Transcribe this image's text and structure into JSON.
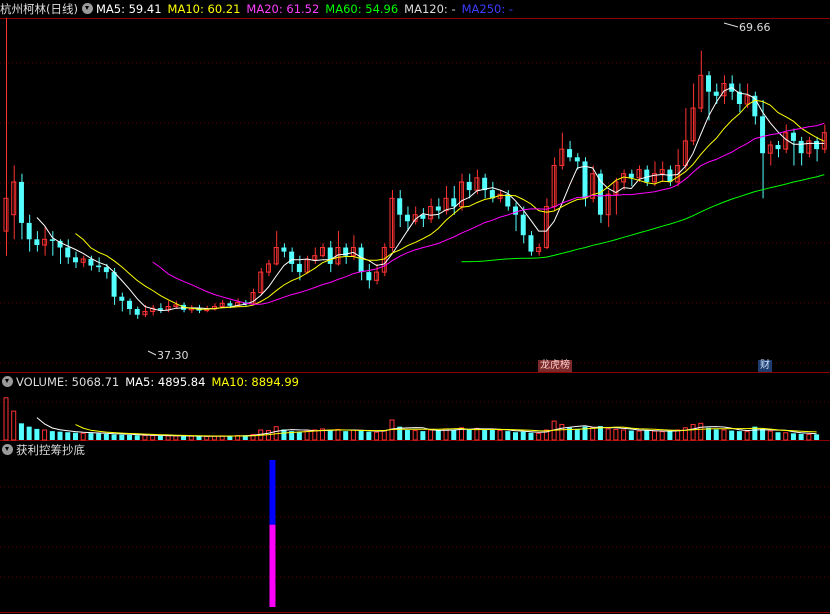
{
  "main_header": {
    "stock_label": "杭州柯林(日线)",
    "ma5": "MA5: 59.41",
    "ma10": "MA10: 60.21",
    "ma20": "MA20: 61.52",
    "ma60": "MA60: 54.96",
    "ma120": "MA120: -",
    "ma250": "MA250: -"
  },
  "volume_header": {
    "volume": "VOLUME: 5068.71",
    "ma5": "MA5: 4895.84",
    "ma10": "MA10: 8894.99"
  },
  "indicator_header": {
    "title": "获利控筹抄底"
  },
  "badges": {
    "lhb": "龙虎榜",
    "cai": "财"
  },
  "colors": {
    "up": "#ff3232",
    "down": "#54ffff",
    "ma5": "#ffffff",
    "ma10": "#ffff00",
    "ma20": "#ff00ff",
    "ma60": "#00ff00",
    "ma250": "#0000ff",
    "grid": "#8b0000",
    "bar_blue": "#0000ff",
    "bar_magenta": "#ff00ff"
  },
  "chart_data": [
    {
      "type": "candlestick",
      "name": "price",
      "y_range": [
        33.5,
        73.5
      ],
      "high_label": "69.66",
      "low_label": "37.30",
      "candles": [
        [
          48,
          52,
          45,
          74
        ],
        [
          50,
          54,
          47,
          56
        ],
        [
          54,
          49,
          47,
          55
        ],
        [
          49,
          47,
          45.5,
          50
        ],
        [
          47,
          46.3,
          45.5,
          48
        ],
        [
          46.3,
          47,
          45,
          48.5
        ],
        [
          47,
          46.8,
          45,
          48
        ],
        [
          46.8,
          46,
          44,
          47
        ],
        [
          46,
          44.8,
          44,
          47
        ],
        [
          44.8,
          44.2,
          43.5,
          45.5
        ],
        [
          44.2,
          44.6,
          43.6,
          45
        ],
        [
          44.6,
          43.8,
          43.2,
          45
        ],
        [
          43.8,
          43.6,
          43,
          44.8
        ],
        [
          43.6,
          43,
          42.2,
          44
        ],
        [
          43,
          40,
          39,
          43.5
        ],
        [
          40,
          39.5,
          38.2,
          40.5
        ],
        [
          39.5,
          38.5,
          37.8,
          39.8
        ],
        [
          38.5,
          37.8,
          37.3,
          38.8
        ],
        [
          37.8,
          38.2,
          37.5,
          39
        ],
        [
          38.2,
          38.6,
          37.7,
          39
        ],
        [
          38.6,
          38.4,
          38,
          39.2
        ],
        [
          38.4,
          38.8,
          38.1,
          39.5
        ],
        [
          38.8,
          39,
          38.5,
          39.5
        ],
        [
          39,
          38.4,
          38.1,
          39.3
        ],
        [
          38.4,
          38.6,
          38,
          39
        ],
        [
          38.6,
          38.3,
          38,
          39
        ],
        [
          38.3,
          38.5,
          38.1,
          38.9
        ],
        [
          38.5,
          38.8,
          38.3,
          39.2
        ],
        [
          38.8,
          39.2,
          38.7,
          39.6
        ],
        [
          39.2,
          38.9,
          38.6,
          39.5
        ],
        [
          38.9,
          39.3,
          38.8,
          39.8
        ],
        [
          39.3,
          39.1,
          38.9,
          39.6
        ],
        [
          39.1,
          40.5,
          39,
          41
        ],
        [
          40.5,
          43,
          40.3,
          43.5
        ],
        [
          43,
          44,
          42.5,
          44.5
        ],
        [
          44,
          46,
          43.8,
          48
        ],
        [
          46,
          45.5,
          44.8,
          46.5
        ],
        [
          45.5,
          44,
          43,
          46
        ],
        [
          44,
          43,
          42,
          45
        ],
        [
          43,
          44.5,
          42.8,
          45
        ],
        [
          44.5,
          45,
          44,
          46
        ],
        [
          45,
          46,
          44.8,
          46.5
        ],
        [
          46,
          44,
          43,
          46.8
        ],
        [
          44,
          46,
          43.8,
          48
        ],
        [
          46,
          45,
          44,
          46.5
        ],
        [
          45,
          46,
          44.5,
          47.5
        ],
        [
          46,
          43,
          42,
          46.5
        ],
        [
          43,
          42,
          41,
          44
        ],
        [
          42,
          43,
          41.5,
          44
        ],
        [
          43,
          46,
          42.5,
          46.5
        ],
        [
          46,
          52,
          45.5,
          53
        ],
        [
          52,
          50,
          48.5,
          53
        ],
        [
          50,
          49.2,
          48,
          51
        ],
        [
          49.2,
          50,
          48.8,
          51
        ],
        [
          50,
          49.5,
          48.5,
          50.8
        ],
        [
          49.5,
          51,
          49,
          52
        ],
        [
          51,
          50.5,
          49.5,
          52
        ],
        [
          50.5,
          52,
          50,
          53.5
        ],
        [
          52,
          51,
          50,
          53.5
        ],
        [
          51,
          54,
          50.5,
          55
        ],
        [
          54,
          53,
          52,
          55
        ],
        [
          53,
          54.5,
          52.5,
          55.5
        ],
        [
          54.5,
          53,
          52,
          55
        ],
        [
          53,
          52,
          51.5,
          54
        ],
        [
          52,
          52.5,
          51.5,
          53
        ],
        [
          52.5,
          51,
          50.5,
          53
        ],
        [
          51,
          50,
          48,
          51.5
        ],
        [
          50,
          47.5,
          46.5,
          51
        ],
        [
          47.5,
          45.5,
          45,
          48
        ],
        [
          45.5,
          46,
          45,
          46.5
        ],
        [
          46,
          51,
          45.8,
          52
        ],
        [
          51,
          56,
          50.5,
          57
        ],
        [
          56,
          58,
          55.5,
          60
        ],
        [
          58,
          57,
          56.5,
          59
        ],
        [
          57,
          56.5,
          55.5,
          57.5
        ],
        [
          56.5,
          52,
          51,
          57
        ],
        [
          52,
          55,
          51.5,
          56
        ],
        [
          55,
          50,
          49,
          55.5
        ],
        [
          50,
          52.5,
          48.5,
          53
        ],
        [
          52.5,
          54,
          50,
          54.5
        ],
        [
          54,
          55,
          53,
          55.5
        ],
        [
          55,
          54.5,
          53.5,
          55.5
        ],
        [
          54.5,
          55.5,
          54,
          56
        ],
        [
          55.5,
          54,
          53.5,
          56
        ],
        [
          54,
          55,
          53.5,
          56.5
        ],
        [
          55,
          55.5,
          54,
          56.5
        ],
        [
          55.5,
          54,
          53.5,
          56
        ],
        [
          54,
          56,
          53.5,
          58
        ],
        [
          56,
          59,
          55.5,
          63
        ],
        [
          59,
          63,
          58.5,
          66
        ],
        [
          63,
          67,
          62.5,
          70
        ],
        [
          67,
          65,
          61.5,
          67.5
        ],
        [
          65,
          64.5,
          63.5,
          66
        ],
        [
          64.5,
          66,
          63.5,
          67
        ],
        [
          66,
          65,
          64,
          67
        ],
        [
          65,
          63.5,
          62.5,
          66
        ],
        [
          63.5,
          64.5,
          63,
          66
        ],
        [
          64.5,
          62,
          61,
          65
        ],
        [
          62,
          57.5,
          52,
          64
        ],
        [
          57.5,
          58.5,
          56,
          59
        ],
        [
          58.5,
          58,
          57,
          59
        ],
        [
          58,
          60,
          57.5,
          61
        ],
        [
          60,
          59,
          56,
          60.5
        ],
        [
          59,
          57.5,
          56,
          59.5
        ],
        [
          57.5,
          59,
          57,
          59.5
        ],
        [
          59,
          58,
          56.5,
          59.5
        ],
        [
          58,
          60,
          57.5,
          61
        ]
      ],
      "overlays": [
        {
          "name": "MA5",
          "color": "#ffffff",
          "start": 4
        },
        {
          "name": "MA10",
          "color": "#ffff00",
          "start": 9
        },
        {
          "name": "MA20",
          "color": "#ff00ff",
          "start": 19
        },
        {
          "name": "MA60",
          "color": "#00ff00",
          "start": 59
        }
      ]
    },
    {
      "type": "bar",
      "name": "volume",
      "y_range": [
        0,
        45000
      ],
      "values": [
        38000,
        26000,
        15000,
        12000,
        10000,
        9000,
        8000,
        7500,
        7000,
        6500,
        6000,
        6200,
        5800,
        5500,
        5000,
        4800,
        4500,
        4300,
        4100,
        4000,
        3800,
        3700,
        3600,
        3500,
        3400,
        3300,
        3200,
        3500,
        3700,
        3900,
        4000,
        4200,
        5000,
        9000,
        8500,
        12000,
        9500,
        8000,
        7500,
        8000,
        9000,
        10000,
        8500,
        9500,
        8000,
        9000,
        8500,
        7500,
        7000,
        8500,
        18000,
        12000,
        9000,
        8500,
        8000,
        9000,
        8800,
        10000,
        9000,
        11000,
        10000,
        10500,
        9500,
        9000,
        8500,
        8000,
        7000,
        7500,
        6500,
        6000,
        9000,
        17000,
        14000,
        11000,
        10000,
        12000,
        11000,
        12500,
        10000,
        9500,
        9000,
        8500,
        8000,
        8500,
        8000,
        7500,
        8000,
        9000,
        11000,
        14000,
        15000,
        11000,
        9500,
        9000,
        8500,
        8000,
        7500,
        12000,
        10000,
        8000,
        7000,
        6500,
        6000,
        5500,
        5000,
        5068.71
      ]
    },
    {
      "type": "bar",
      "name": "获利控筹抄底",
      "index": 34,
      "segments": [
        {
          "color": "#0000ff",
          "from": 0.56,
          "to": 1.0
        },
        {
          "color": "#ff00ff",
          "from": 0.0,
          "to": 0.56
        }
      ]
    }
  ]
}
